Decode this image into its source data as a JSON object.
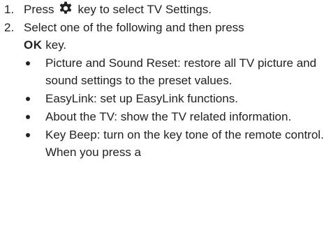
{
  "steps": [
    {
      "number": "1.",
      "before_icon": "Press",
      "icon": "gear-icon",
      "after_icon": "key to select TV Settings."
    },
    {
      "number": "2.",
      "text": "Select one of the following and then press",
      "key_label": "OK",
      "after_key": "key."
    }
  ],
  "bullets": [
    "Picture and Sound Reset: restore all TV picture and sound settings to the preset values.",
    "EasyLink: set up EasyLink functions.",
    "About the TV: show the TV related information.",
    "Key Beep: turn on the key tone of the remote control. When you press a"
  ]
}
